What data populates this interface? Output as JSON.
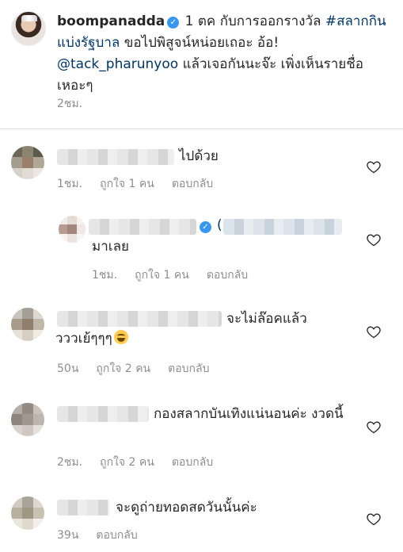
{
  "post": {
    "username": "boompanadda",
    "caption_part1": " 1 ตค กับการออกรางวัล ",
    "hashtag": "#สลากกินแบ่งรัฐบาล",
    "caption_part2": " ขอไปพิสูจน์หน่อยเถอะ อ้อ! ",
    "mention": "@tack_pharunyoo",
    "caption_part3": " แล้วเจอกันนะจ๊ะ เพิ่งเห็นรายชื่อเหอะๆ",
    "time": "2ชม."
  },
  "comments": [
    {
      "text": "ไปด้วย",
      "time": "1ชม.",
      "likes": "ถูกใจ 1 คน",
      "reply": "ตอบกลับ"
    },
    {
      "text": "มาเลย",
      "time": "1ชม.",
      "likes": "ถูกใจ 1 คน",
      "reply": "ตอบกลับ",
      "mention_suffix": "("
    },
    {
      "text": "จะไม่ล๊อคแล้ววววเย้ๆๆๆ",
      "time": "50น",
      "likes": "ถูกใจ 2 คน",
      "reply": "ตอบกลับ"
    },
    {
      "text": "กองสลากบันเทิงแน่นอนค่ะ งวดนี้",
      "time": "2ชม.",
      "likes": "ถูกใจ 2 คน",
      "reply": "ตอบกลับ"
    },
    {
      "text": "จะดูถ่ายทอดสดวันนั้นค่ะ",
      "time": "39น",
      "reply": "ตอบกลับ"
    }
  ],
  "icons": {
    "verified": "verified-badge-icon",
    "like": "heart-outline-icon",
    "emoji": "tears-of-joy-emoji-icon"
  },
  "colors": {
    "accent": "#3897f0",
    "link": "#003569",
    "meta": "#8e8e8e"
  }
}
